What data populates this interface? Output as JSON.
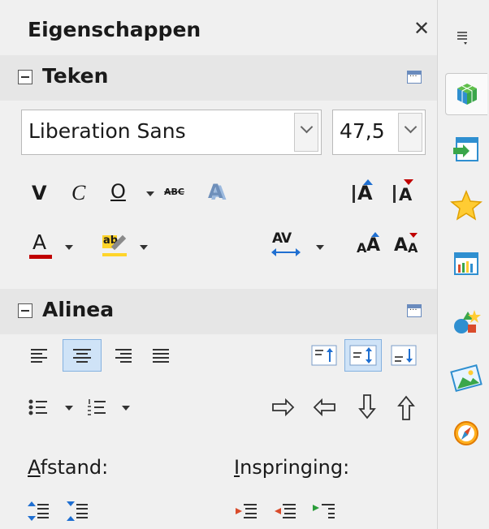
{
  "panel": {
    "title": "Eigenschappen"
  },
  "teken": {
    "title": "Teken",
    "font_name": "Liberation Sans",
    "font_size": "47,5",
    "bold_glyph": "V",
    "italic_glyph": "C",
    "underline_glyph": "O",
    "strike_glyph": "ABC",
    "shadow_glyph": "A",
    "grow_glyph": "A",
    "shrink_glyph": "A",
    "font_color_glyph": "A",
    "highlight_glyph": "ab",
    "spacing_glyph": "AV",
    "upper_glyph": "A",
    "lower_glyph": "A"
  },
  "alinea": {
    "title": "Alinea",
    "spacing_label_u": "A",
    "spacing_label_rest": "fstand:",
    "indent_label_u": "I",
    "indent_label_rest": "nspringing:"
  },
  "colors": {
    "font_color": "#c00000",
    "highlight": "#ffd42a",
    "accent_blue": "#1f6fd1"
  }
}
